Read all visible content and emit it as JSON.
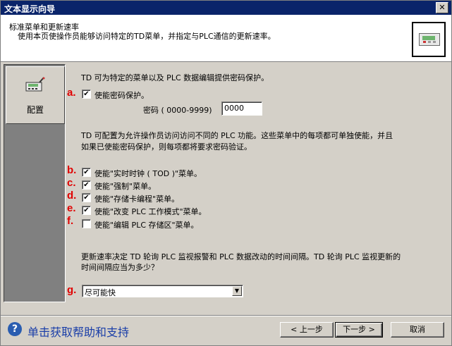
{
  "window": {
    "title": "文本显示向导"
  },
  "header": {
    "title": "标准菜单和更新速率",
    "description": "使用本页使操作员能够访问特定的TD菜单，并指定与PLC通信的更新速率。",
    "icon": "td-device-icon"
  },
  "sidebar": {
    "items": [
      {
        "label": "配置",
        "icon": "td-config-icon"
      }
    ]
  },
  "content": {
    "intro": "TD 可为特定的菜单以及 PLC 数据编辑提供密码保护。",
    "password_protect": {
      "marker": "a.",
      "label": "使能密码保护。",
      "checked": true
    },
    "password": {
      "label": "密码 ( 0000-9999)",
      "value": "0000"
    },
    "menu_intro_line1": "TD 可配置为允许操作员访问访问不同的 PLC 功能。这些菜单中的每项都可单独使能，并且",
    "menu_intro_line2": "如果已使能密码保护，则每项都将要求密码验证。",
    "menus": [
      {
        "marker": "b.",
        "label": "使能\"实时时钟 ( TOD )\"菜单。",
        "checked": true
      },
      {
        "marker": "c.",
        "label": "使能\"强制\"菜单。",
        "checked": true
      },
      {
        "marker": "d.",
        "label": "使能\"存储卡编程\"菜单。",
        "checked": true
      },
      {
        "marker": "e.",
        "label": "使能\"改变 PLC 工作模式\"菜单。",
        "checked": true
      },
      {
        "marker": "f.",
        "label": "使能\"编辑 PLC 存储区\"菜单。",
        "checked": false
      }
    ],
    "rate_line1": "更新速率决定 TD 轮询 PLC 监视报警和 PLC 数据改动的时间间隔。TD 轮询 PLC 监视更新的",
    "rate_line2": "时间间隔应当为多少？",
    "rate_select": {
      "marker": "g.",
      "value": "尽可能快"
    }
  },
  "footer": {
    "help_text": "单击获取帮助和支持",
    "help_icon": "help-icon",
    "back_label": "< 上一步",
    "next_label": "下一步 >",
    "cancel_label": "取消"
  },
  "colors": {
    "titlebar": "#0a246a",
    "marker": "#e00000",
    "link": "#1a3ea8"
  }
}
